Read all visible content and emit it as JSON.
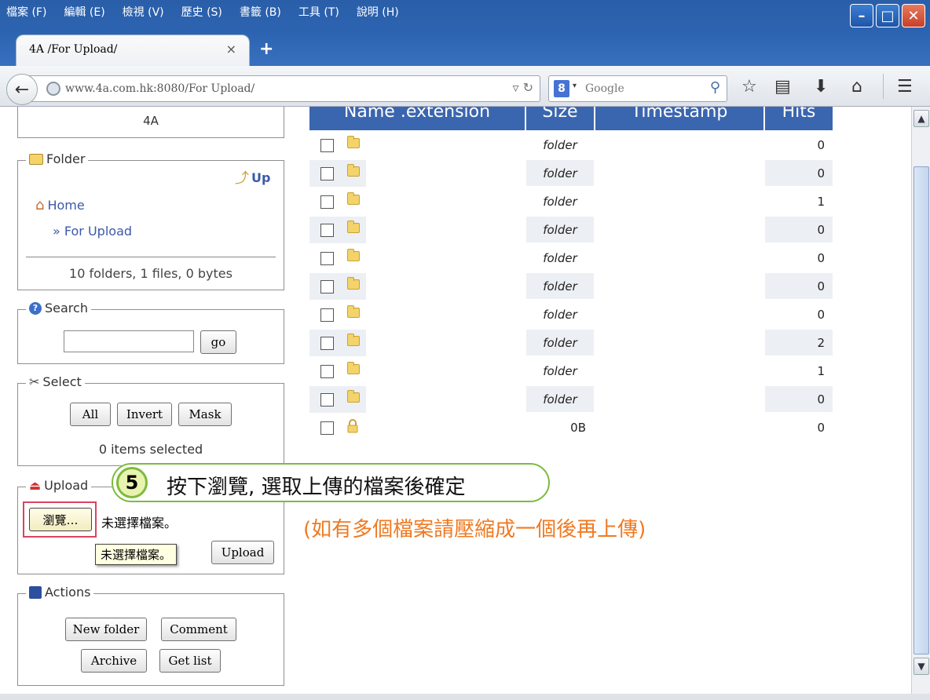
{
  "menubar": [
    "檔案 (F)",
    "編輯 (E)",
    "檢視 (V)",
    "歷史 (S)",
    "書籤 (B)",
    "工具 (T)",
    "說明 (H)"
  ],
  "window_buttons": {
    "minimize": "–",
    "maximize": "□",
    "close": "✕"
  },
  "tab": {
    "title": "4A /For Upload/",
    "close": "×",
    "new": "+"
  },
  "nav": {
    "url": "www.4a.com.hk:8080/For Upload/",
    "search_placeholder": "Google",
    "search_engine_letter": "8"
  },
  "sidebar": {
    "site_name": "4A",
    "folder": {
      "legend": "Folder",
      "up_label": "Up",
      "home_label": "Home",
      "current_label": "» For Upload",
      "summary": "10 folders, 1 files, 0 bytes"
    },
    "search": {
      "legend": "Search",
      "value": "",
      "go_label": "go"
    },
    "select": {
      "legend": "Select",
      "all_label": "All",
      "invert_label": "Invert",
      "mask_label": "Mask",
      "status": "0 items selected"
    },
    "upload": {
      "legend": "Upload",
      "browse_label": "瀏覽…",
      "file_status": "未選擇檔案。",
      "tooltip": "未選擇檔案。",
      "upload_label": "Upload"
    },
    "actions": {
      "legend": "Actions",
      "new_folder_label": "New folder",
      "comment_label": "Comment",
      "archive_label": "Archive",
      "get_list_label": "Get list"
    }
  },
  "file_table": {
    "headers": [
      "Name .extension",
      "Size",
      "Timestamp",
      "Hits"
    ],
    "rows": [
      {
        "name": "",
        "size": "folder",
        "timestamp": "",
        "hits": "0"
      },
      {
        "name": "",
        "size": "folder",
        "timestamp": "",
        "hits": "0"
      },
      {
        "name": "",
        "size": "folder",
        "timestamp": "",
        "hits": "1"
      },
      {
        "name": "",
        "size": "folder",
        "timestamp": "",
        "hits": "0"
      },
      {
        "name": "",
        "size": "folder",
        "timestamp": "",
        "hits": "0"
      },
      {
        "name": "",
        "size": "folder",
        "timestamp": "",
        "hits": "0"
      },
      {
        "name": "",
        "size": "folder",
        "timestamp": "",
        "hits": "0"
      },
      {
        "name": "",
        "size": "folder",
        "timestamp": "",
        "hits": "2"
      },
      {
        "name": "",
        "size": "folder",
        "timestamp": "",
        "hits": "1"
      },
      {
        "name": "",
        "size": "folder",
        "timestamp": "",
        "hits": "0"
      },
      {
        "name": "",
        "size": "0B",
        "timestamp": "",
        "hits": "0"
      }
    ]
  },
  "annotation": {
    "step": "5",
    "text": "按下瀏覽, 選取上傳的檔案後確定",
    "note": "(如有多個檔案請壓縮成一個後再上傳)"
  },
  "colors": {
    "title_bar": "#2c63b0",
    "table_header": "#3a66b0",
    "link": "#3b5aa8",
    "callout_border": "#7dbb3c",
    "note_text": "#f07a22"
  }
}
